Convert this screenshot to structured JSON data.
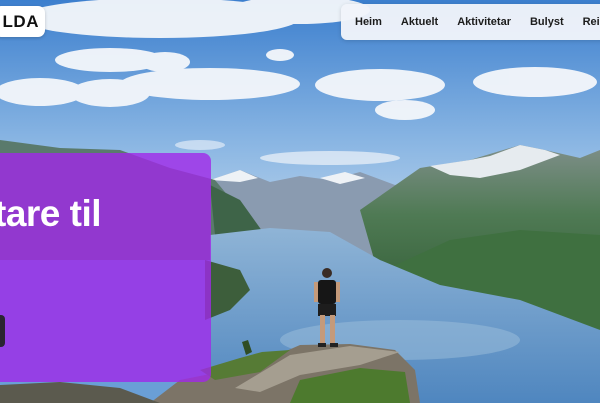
{
  "logo": {
    "text": "LDA"
  },
  "nav": {
    "items": [
      {
        "label": "Heim"
      },
      {
        "label": "Aktuelt"
      },
      {
        "label": "Aktivitetar"
      },
      {
        "label": "Bulyst"
      },
      {
        "label": "Reise"
      }
    ]
  },
  "hero": {
    "heading": "tare til"
  },
  "colors": {
    "card": "#a028e8",
    "nav_bg": "#f0f4fa",
    "sky": "#5f98d8",
    "water": "#5c8fc4"
  }
}
